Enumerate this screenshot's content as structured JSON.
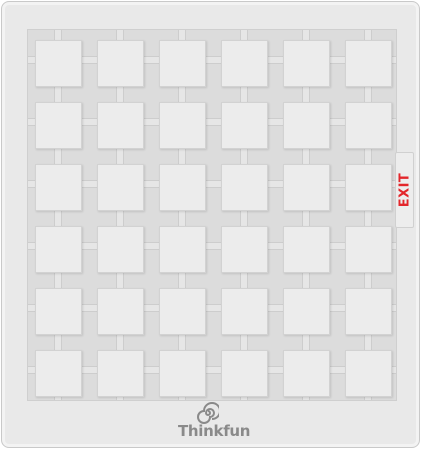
{
  "board": {
    "rows": 6,
    "cols": 6,
    "pieces": []
  },
  "exit": {
    "label": "EXIT",
    "row": 3,
    "color": "#e3262b"
  },
  "brand": {
    "logo_text": "Thinkfun",
    "icon": "swirl-icon"
  }
}
